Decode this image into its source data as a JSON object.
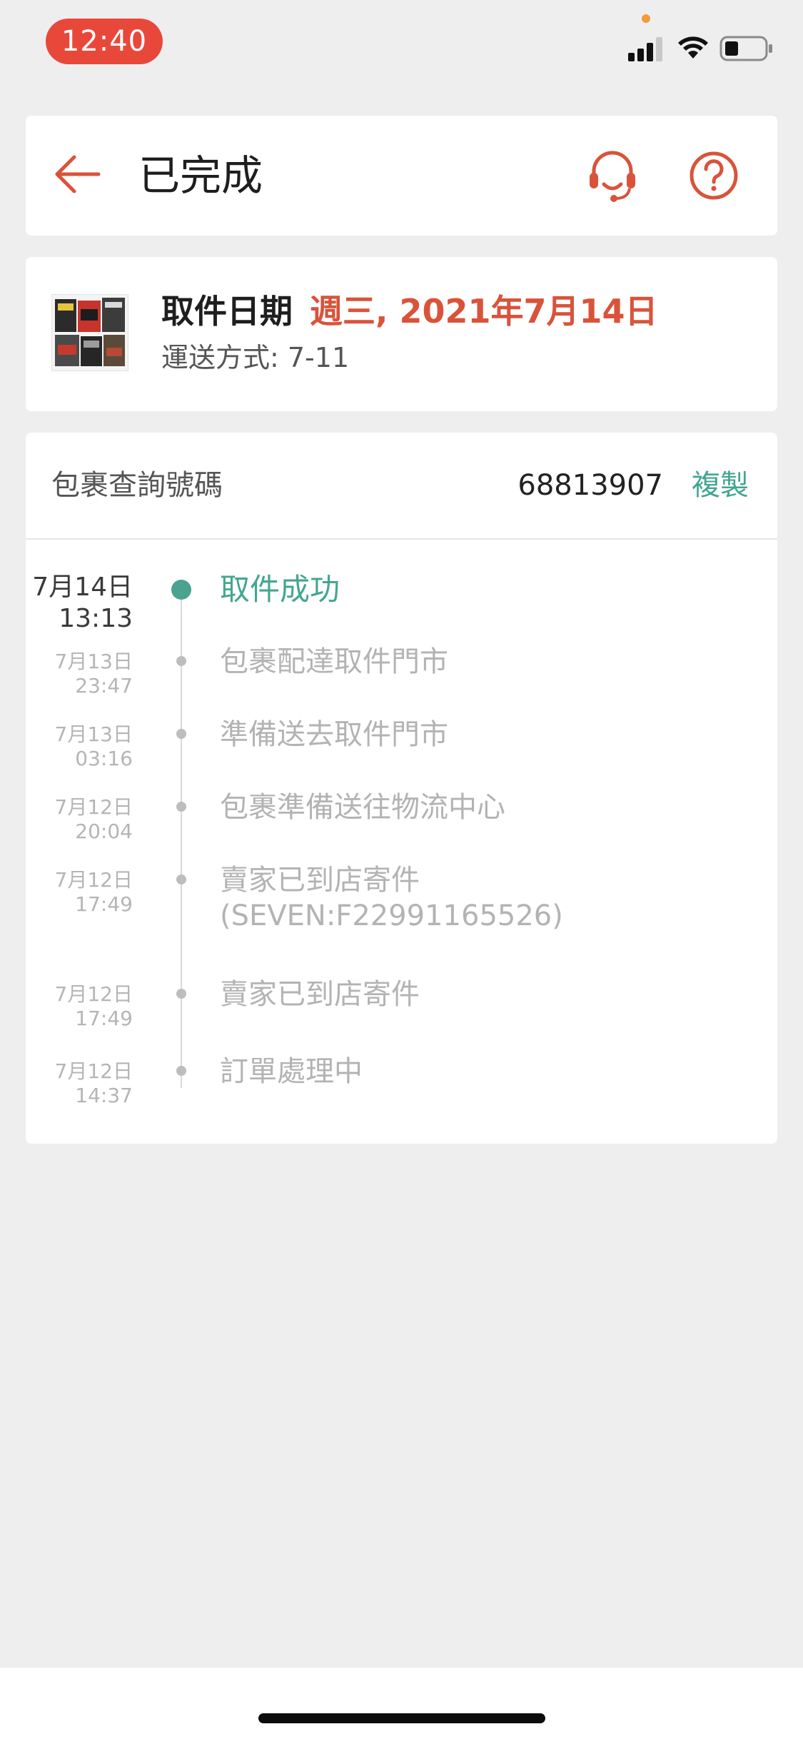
{
  "status_bar": {
    "time": "12:40"
  },
  "header": {
    "title": "已完成",
    "icons": [
      "back-arrow-icon",
      "customer-service-headset-icon",
      "help-question-icon"
    ]
  },
  "pickup": {
    "label": "取件日期",
    "date": "週三, 2021年7月14日",
    "shipping_method": "運送方式: 7-11"
  },
  "tracking": {
    "label": "包裹查詢號碼",
    "number": "68813907",
    "copy_label": "複製",
    "events": [
      {
        "date": "7月14日",
        "time": "13:13",
        "text": "取件成功"
      },
      {
        "date": "7月13日",
        "time": "23:47",
        "text": "包裹配達取件門市"
      },
      {
        "date": "7月13日",
        "time": "03:16",
        "text": "準備送去取件門市"
      },
      {
        "date": "7月12日",
        "time": "20:04",
        "text": "包裹準備送往物流中心"
      },
      {
        "date": "7月12日",
        "time": "17:49",
        "text": "賣家已到店寄件",
        "text2": "(SEVEN:F22991165526)"
      },
      {
        "date": "7月12日",
        "time": "17:49",
        "text": "賣家已到店寄件"
      },
      {
        "date": "7月12日",
        "time": "14:37",
        "text": "訂單處理中"
      }
    ]
  },
  "colors": {
    "accent": "#d9533a",
    "success": "#43a690",
    "status_pill": "#e8483a",
    "background": "#efeeef"
  }
}
